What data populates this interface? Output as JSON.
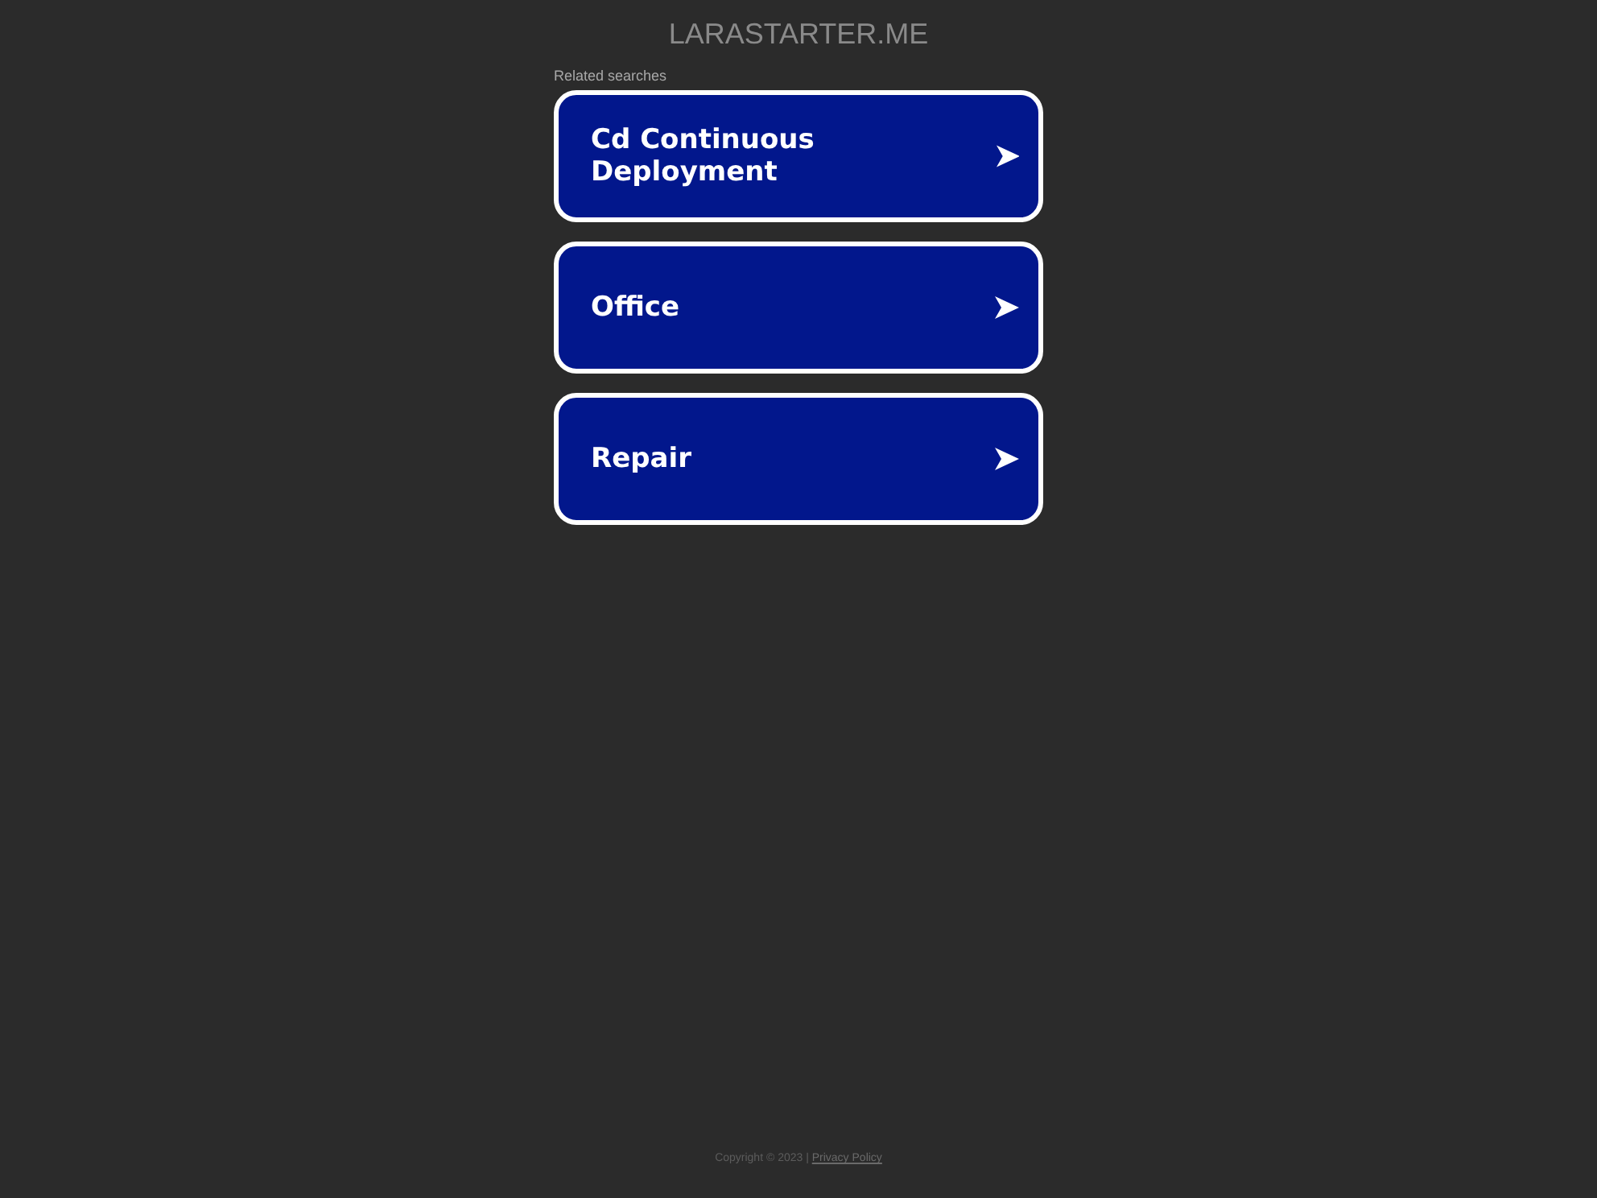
{
  "site_title": "LARASTARTER.ME",
  "related_heading": "Related searches",
  "links": [
    {
      "label": "Cd Continuous Deployment"
    },
    {
      "label": "Office"
    },
    {
      "label": "Repair"
    }
  ],
  "footer": {
    "copyright": "Copyright © 2023 |",
    "privacy_link": "Privacy Policy"
  }
}
